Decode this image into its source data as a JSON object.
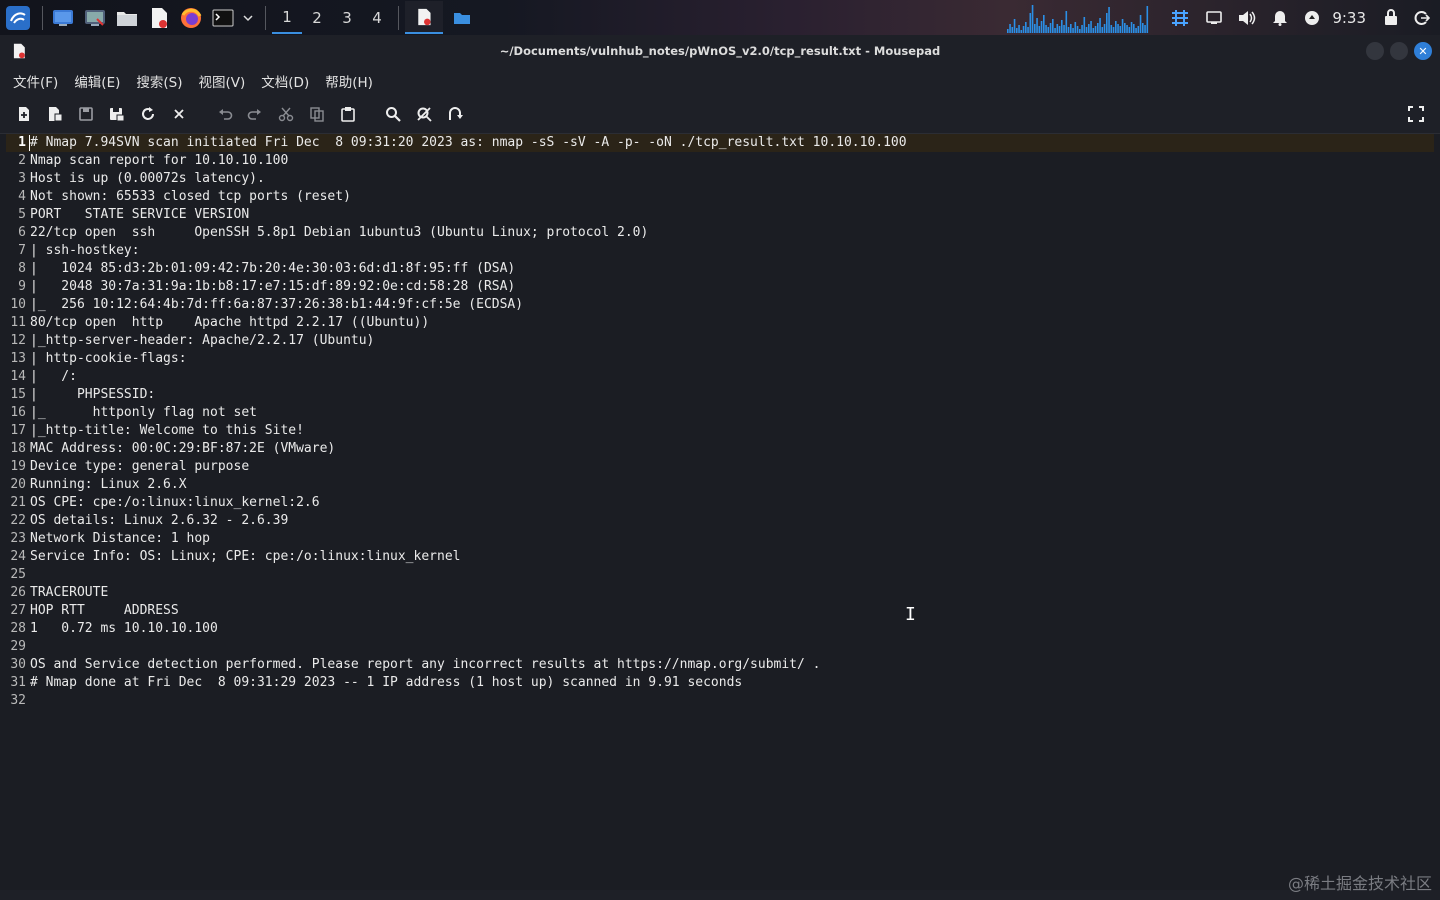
{
  "taskbar": {
    "workspaces": [
      "1",
      "2",
      "3",
      "4"
    ],
    "active_workspace": "1",
    "clock": "9:33",
    "accent_color": "#3a8fe0",
    "launchers": [
      "kali-menu-icon",
      "desktop-icon",
      "terminal-emulator-icon",
      "file-manager-icon",
      "text-editor-icon",
      "firefox-icon",
      "terminal-icon"
    ],
    "tray_icons": [
      "input-method-icon",
      "display-icon",
      "volume-icon",
      "notification-bell-icon",
      "network-icon",
      "lock-icon",
      "logout-icon"
    ]
  },
  "window": {
    "title": "~/Documents/vulnhub_notes/pWnOS_v2.0/tcp_result.txt - Mousepad",
    "close_glyph": "✕"
  },
  "menu": [
    "文件(F)",
    "编辑(E)",
    "搜索(S)",
    "视图(V)",
    "文档(D)",
    "帮助(H)"
  ],
  "toolbar": {
    "buttons": [
      "new-document",
      "new-window",
      "save",
      "save-as",
      "reload",
      "close",
      "undo",
      "redo",
      "cut",
      "copy",
      "paste",
      "find",
      "find-and-replace",
      "go-to-line",
      "fullscreen"
    ]
  },
  "editor": {
    "current_line": 1,
    "lines": [
      "# Nmap 7.94SVN scan initiated Fri Dec  8 09:31:20 2023 as: nmap -sS -sV -A -p- -oN ./tcp_result.txt 10.10.10.100",
      "Nmap scan report for 10.10.10.100",
      "Host is up (0.00072s latency).",
      "Not shown: 65533 closed tcp ports (reset)",
      "PORT   STATE SERVICE VERSION",
      "22/tcp open  ssh     OpenSSH 5.8p1 Debian 1ubuntu3 (Ubuntu Linux; protocol 2.0)",
      "| ssh-hostkey: ",
      "|   1024 85:d3:2b:01:09:42:7b:20:4e:30:03:6d:d1:8f:95:ff (DSA)",
      "|   2048 30:7a:31:9a:1b:b8:17:e7:15:df:89:92:0e:cd:58:28 (RSA)",
      "|_  256 10:12:64:4b:7d:ff:6a:87:37:26:38:b1:44:9f:cf:5e (ECDSA)",
      "80/tcp open  http    Apache httpd 2.2.17 ((Ubuntu))",
      "|_http-server-header: Apache/2.2.17 (Ubuntu)",
      "| http-cookie-flags: ",
      "|   /: ",
      "|     PHPSESSID: ",
      "|_      httponly flag not set",
      "|_http-title: Welcome to this Site!",
      "MAC Address: 00:0C:29:BF:87:2E (VMware)",
      "Device type: general purpose",
      "Running: Linux 2.6.X",
      "OS CPE: cpe:/o:linux:linux_kernel:2.6",
      "OS details: Linux 2.6.32 - 2.6.39",
      "Network Distance: 1 hop",
      "Service Info: OS: Linux; CPE: cpe:/o:linux:linux_kernel",
      "",
      "TRACEROUTE",
      "HOP RTT     ADDRESS",
      "1   0.72 ms 10.10.10.100",
      "",
      "OS and Service detection performed. Please report any incorrect results at https://nmap.org/submit/ .",
      "# Nmap done at Fri Dec  8 09:31:29 2023 -- 1 IP address (1 host up) scanned in 9.91 seconds",
      ""
    ]
  },
  "watermark": "@稀土掘金技术社区"
}
